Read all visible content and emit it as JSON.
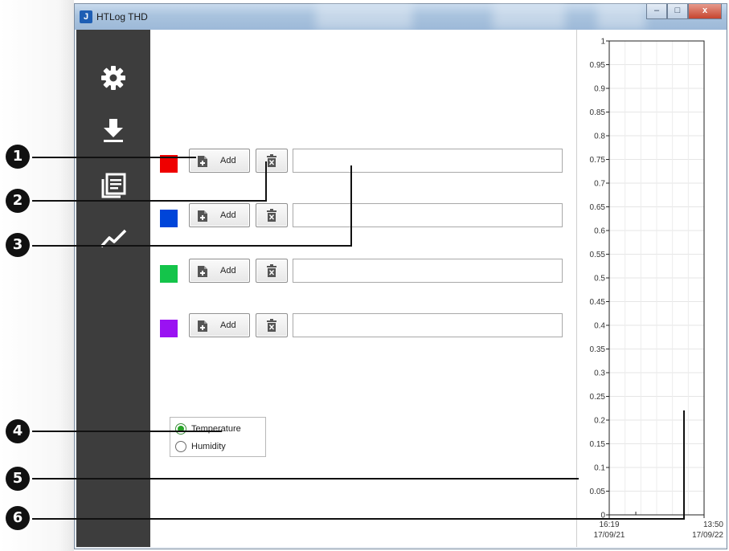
{
  "window": {
    "title": "HTLog THD",
    "app_icon_glyph": "J",
    "buttons": {
      "minimize": "–",
      "maximize": "□",
      "close": "x"
    }
  },
  "sidebar": {
    "items": [
      {
        "icon": "gear-icon"
      },
      {
        "icon": "download-icon"
      },
      {
        "icon": "documents-icon"
      },
      {
        "icon": "line-chart-icon"
      }
    ]
  },
  "files": {
    "add_label": "Add",
    "rows": [
      {
        "color": "#ef0000",
        "filename": ""
      },
      {
        "color": "#0045d9",
        "filename": ""
      },
      {
        "color": "#14c44a",
        "filename": ""
      },
      {
        "color": "#9a12f2",
        "filename": ""
      }
    ]
  },
  "measurement": {
    "options": [
      "Temperature",
      "Humidity"
    ],
    "selected": "Temperature"
  },
  "chart_data": {
    "type": "line",
    "series": [],
    "ylim": [
      0,
      1
    ],
    "y_ticks": [
      "0",
      "0.05",
      "0.1",
      "0.15",
      "0.2",
      "0.25",
      "0.3",
      "0.35",
      "0.4",
      "0.45",
      "0.5",
      "0.55",
      "0.6",
      "0.65",
      "0.7",
      "0.75",
      "0.8",
      "0.85",
      "0.9",
      "0.95",
      "1"
    ],
    "x_ticks": [
      {
        "time": "16:19",
        "date": "17/09/21"
      },
      {
        "time": "13:50",
        "date": "17/09/22"
      }
    ],
    "grid": true
  },
  "callouts": [
    "1",
    "2",
    "3",
    "4",
    "5",
    "6"
  ]
}
